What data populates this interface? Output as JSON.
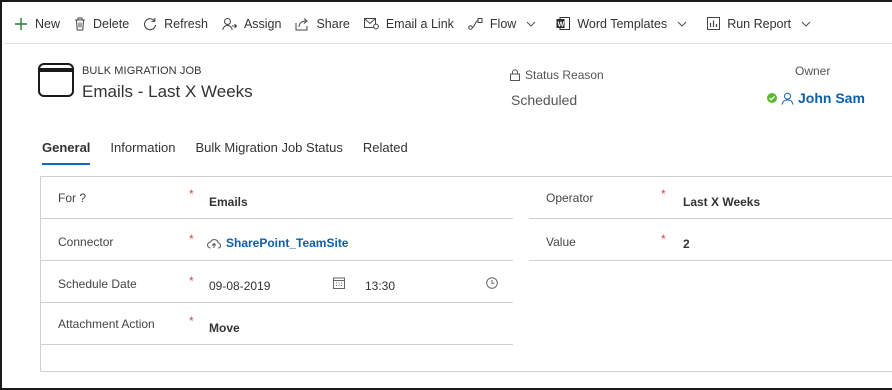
{
  "commandbar": {
    "new": "New",
    "delete": "Delete",
    "refresh": "Refresh",
    "assign": "Assign",
    "share": "Share",
    "email_link": "Email a Link",
    "flow": "Flow",
    "word_templates": "Word Templates",
    "run_report": "Run Report"
  },
  "header": {
    "entity_type": "BULK MIGRATION JOB",
    "title": "Emails - Last X Weeks",
    "status_reason_label": "Status Reason",
    "status_reason_value": "Scheduled",
    "owner_label": "Owner",
    "owner_value": "John Sam"
  },
  "tabs": [
    "General",
    "Information",
    "Bulk Migration Job Status",
    "Related"
  ],
  "form": {
    "left": {
      "for_label": "For ?",
      "for_value": "Emails",
      "connector_label": "Connector",
      "connector_value": "SharePoint_TeamSite",
      "schedule_label": "Schedule Date",
      "schedule_date": "09-08-2019",
      "schedule_time": "13:30",
      "attachment_label": "Attachment Action",
      "attachment_value": "Move"
    },
    "right": {
      "operator_label": "Operator",
      "operator_value": "Last X Weeks",
      "value_label": "Value",
      "value_value": "2"
    },
    "required_mark": "*"
  },
  "colors": {
    "link": "#0f5ea8",
    "accent": "#0f6cbd",
    "required": "#e04040",
    "presence": "#5db82f"
  }
}
